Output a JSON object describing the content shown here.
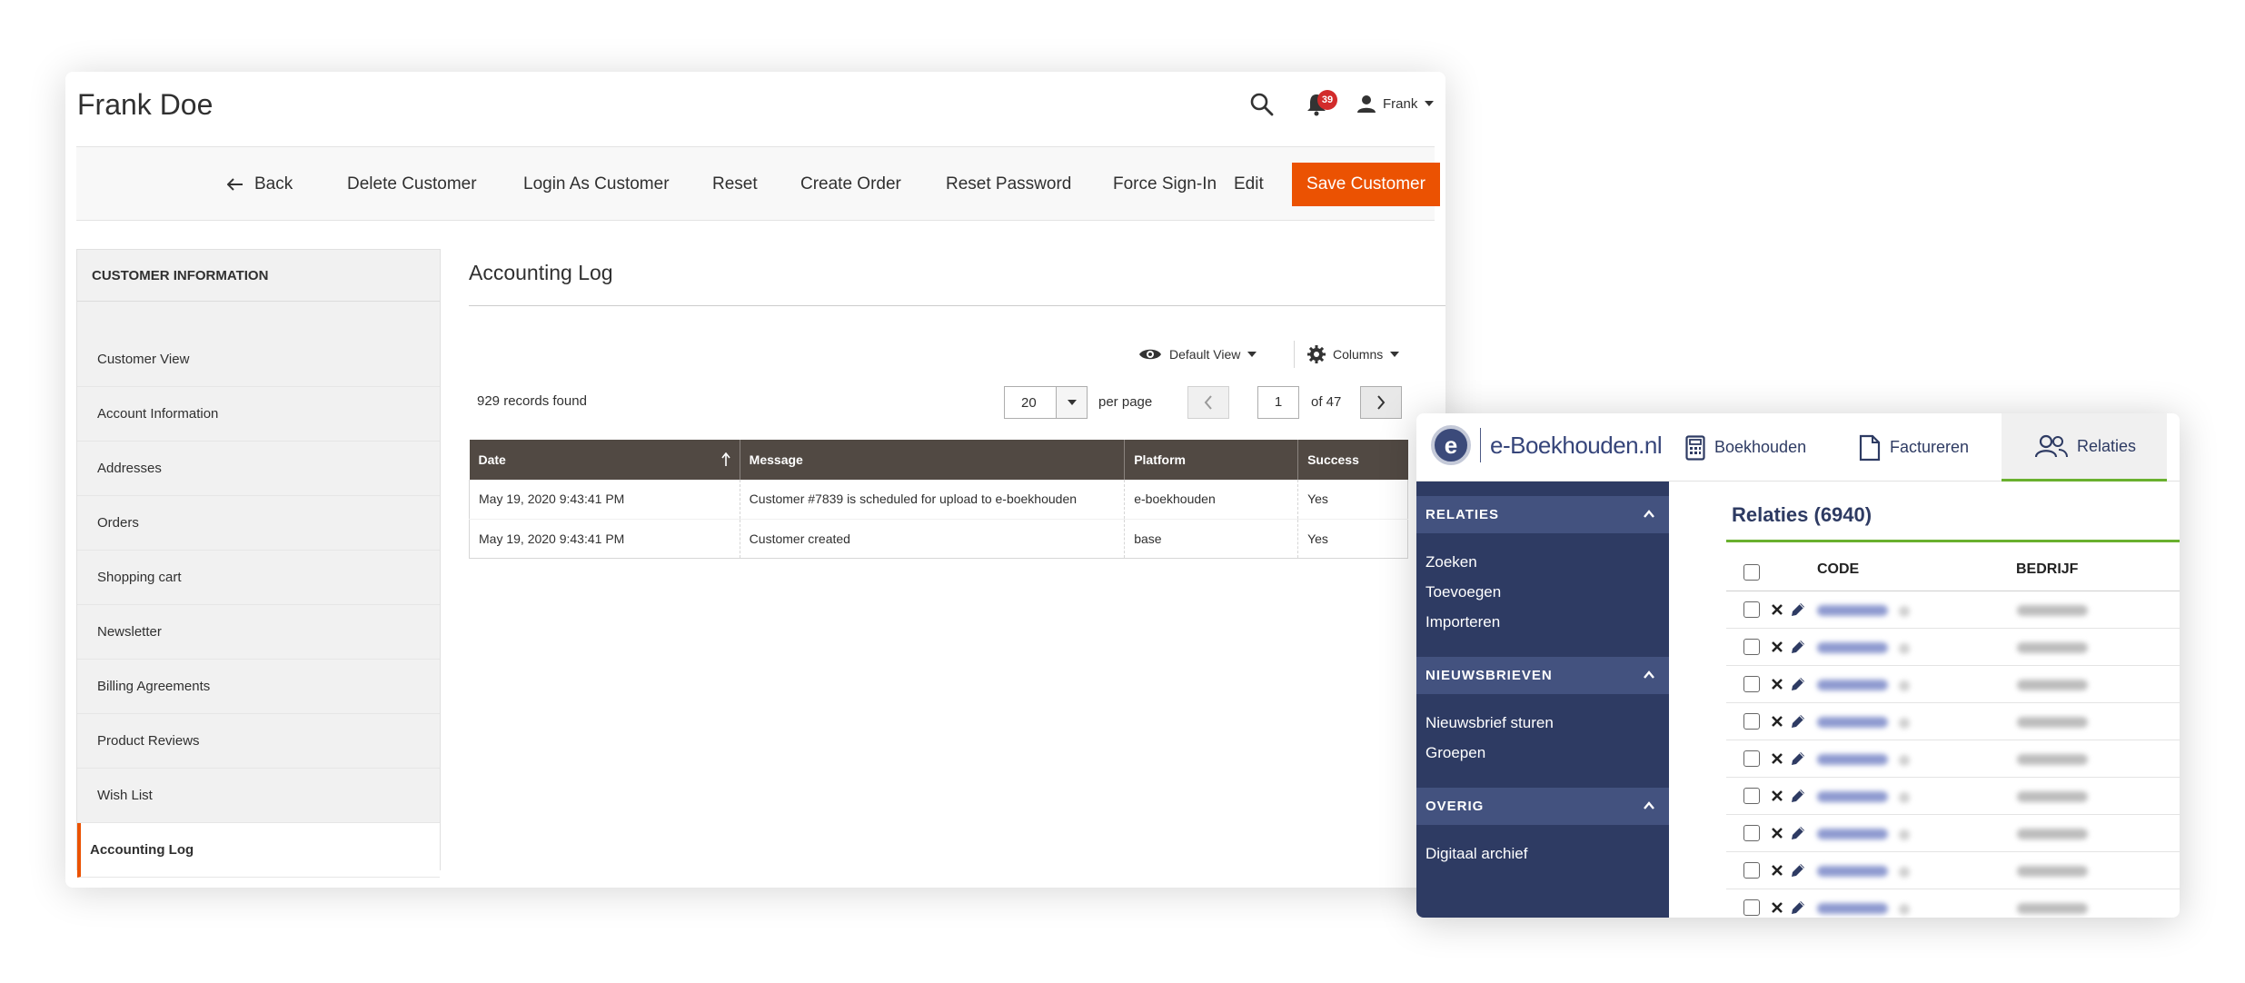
{
  "magento": {
    "page_title": "Frank Doe",
    "notification_count": "39",
    "user_name": "Frank",
    "actions": {
      "back": "Back",
      "delete_customer": "Delete Customer",
      "login_as_customer": "Login As Customer",
      "reset": "Reset",
      "create_order": "Create Order",
      "reset_password": "Reset Password",
      "force_sign_in": "Force Sign-In",
      "edit": "Edit",
      "save_customer": "Save Customer"
    },
    "sidebar": {
      "heading": "CUSTOMER INFORMATION",
      "items": [
        {
          "label": "Customer View"
        },
        {
          "label": "Account Information"
        },
        {
          "label": "Addresses"
        },
        {
          "label": "Orders"
        },
        {
          "label": "Shopping cart"
        },
        {
          "label": "Newsletter"
        },
        {
          "label": "Billing Agreements"
        },
        {
          "label": "Product Reviews"
        },
        {
          "label": "Wish List"
        },
        {
          "label": "Accounting Log"
        }
      ]
    },
    "section_title": "Accounting Log",
    "toolbar": {
      "default_view": "Default View",
      "columns": "Columns",
      "records_found": "929 records found",
      "per_page_value": "20",
      "per_page_label": "per page",
      "current_page": "1",
      "page_total": "of 47"
    },
    "table": {
      "headers": [
        "Date",
        "Message",
        "Platform",
        "Success"
      ],
      "rows": [
        [
          "May 19, 2020 9:43:41 PM",
          "Customer #7839 is scheduled for upload to e-boekhouden",
          "e-boekhouden",
          "Yes"
        ],
        [
          "May 19, 2020 9:43:41 PM",
          "Customer created",
          "base",
          "Yes"
        ]
      ]
    },
    "colors": {
      "accent": "#eb5202",
      "table_header": "#514943",
      "badge": "#d22b2b"
    }
  },
  "eboekhouden": {
    "logo_letter": "e",
    "logo_text": "e-Boekhouden.nl",
    "tabs": [
      {
        "label": "Boekhouden",
        "icon": "calculator-icon"
      },
      {
        "label": "Factureren",
        "icon": "document-icon"
      },
      {
        "label": "Relaties",
        "icon": "users-icon"
      }
    ],
    "sidebar": {
      "groups": [
        {
          "title": "RELATIES",
          "links": [
            "Zoeken",
            "Toevoegen",
            "Importeren"
          ]
        },
        {
          "title": "NIEUWSBRIEVEN",
          "links": [
            "Nieuwsbrief sturen",
            "Groepen"
          ]
        },
        {
          "title": "OVERIG",
          "links": [
            "Digitaal archief"
          ]
        }
      ]
    },
    "main_title": "Relaties (6940)",
    "columns": [
      "CODE",
      "BEDRIJF"
    ],
    "colors": {
      "nav": "#2e3b63",
      "nav_group": "#43527f",
      "accent": "#69b02e"
    }
  }
}
